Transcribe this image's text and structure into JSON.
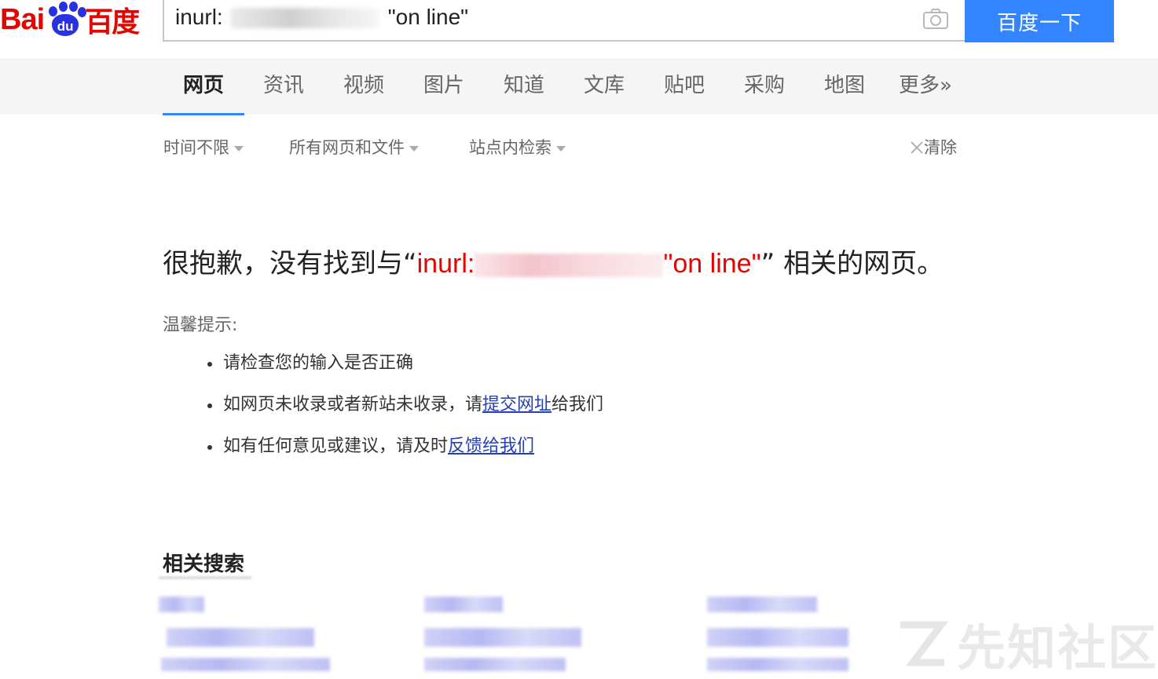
{
  "logo": {
    "latin": "Bai",
    "paw_text": "du",
    "chinese": "百度"
  },
  "search": {
    "query_prefix": "inurl:",
    "query_suffix": "\"on line\"",
    "button_label": "百度一下"
  },
  "tabs": [
    {
      "label": "网页",
      "active": true
    },
    {
      "label": "资讯"
    },
    {
      "label": "视频"
    },
    {
      "label": "图片"
    },
    {
      "label": "知道"
    },
    {
      "label": "文库"
    },
    {
      "label": "贴吧"
    },
    {
      "label": "采购"
    },
    {
      "label": "地图"
    },
    {
      "label": "更多»"
    }
  ],
  "filters": {
    "time": "时间不限",
    "type": "所有网页和文件",
    "site": "站点内检索",
    "clear": "清除"
  },
  "no_result": {
    "before": "很抱歉，没有找到与",
    "quote_open": "“",
    "query_prefix": "inurl:",
    "query_suffix": "\"on line\"",
    "quote_close": "”",
    "after": "相关的网页。"
  },
  "tips": {
    "title": "温馨提示:",
    "item1": "请检查您的输入是否正确",
    "item2_before": "如网页未收录或者新站未收录，请",
    "item2_link": "提交网址",
    "item2_after": "给我们",
    "item3_before": "如有任何意见或建议，请及时",
    "item3_link": "反馈给我们"
  },
  "related": {
    "title": "相关搜索"
  },
  "watermark": {
    "text": "先知社区"
  },
  "colors": {
    "brand_red": "#e10601",
    "brand_blue": "#2932e1",
    "button_blue": "#3385ff",
    "link_blue": "#2440b3"
  }
}
